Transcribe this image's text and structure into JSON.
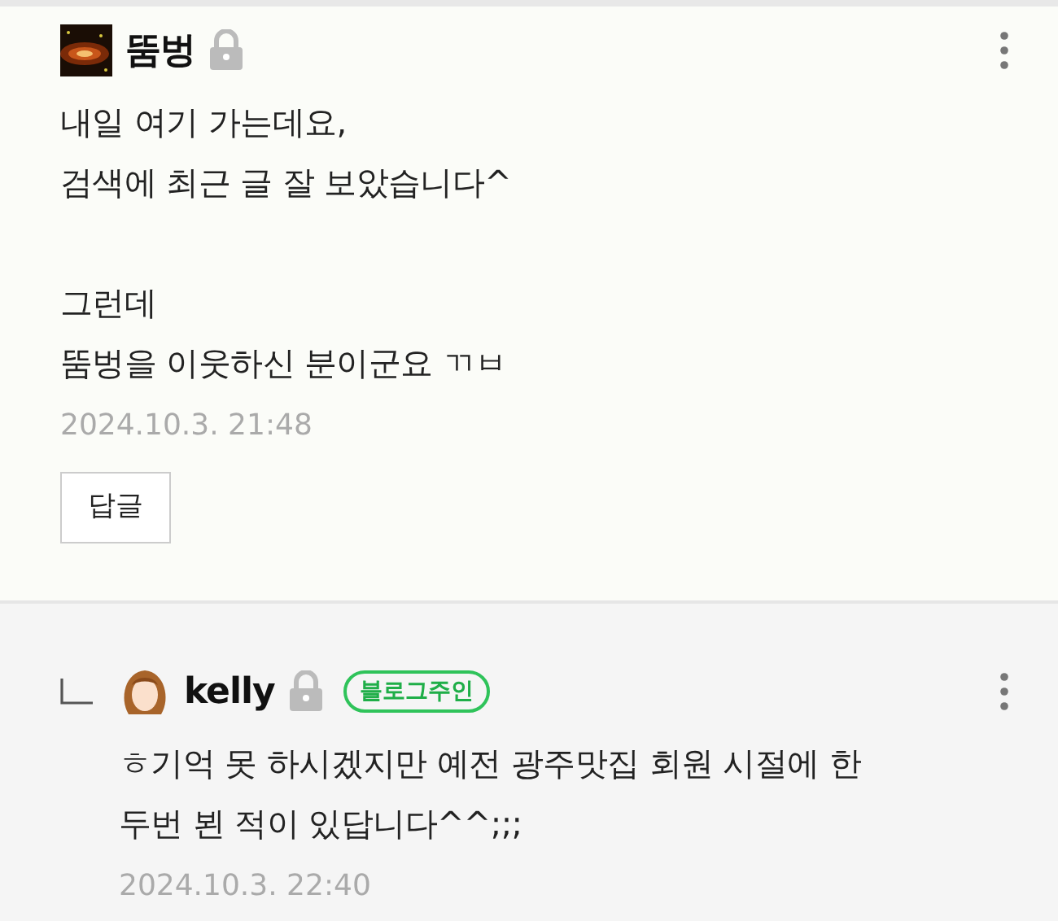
{
  "comments": [
    {
      "kind": "comment",
      "author": "뚬벙",
      "locked": true,
      "paragraphs": [
        [
          "내일 여기 가는데요,",
          "검색에 최근 글 잘 보았습니다^"
        ],
        [
          "그런데",
          "뚬벙을 이웃하신 분이군요 ㄲㅂ"
        ]
      ],
      "date": "2024.10.3. 21:48",
      "reply_button": "답글"
    },
    {
      "kind": "reply",
      "author": "kelly",
      "locked": true,
      "badge": "블로그주인",
      "paragraphs": [
        [
          "ㅎ기억 못 하시겠지만 예전 광주맛집 회원 시절에 한",
          "두번 뵌 적이 있답니다^^;;;"
        ]
      ],
      "date": "2024.10.3. 22:40"
    }
  ]
}
